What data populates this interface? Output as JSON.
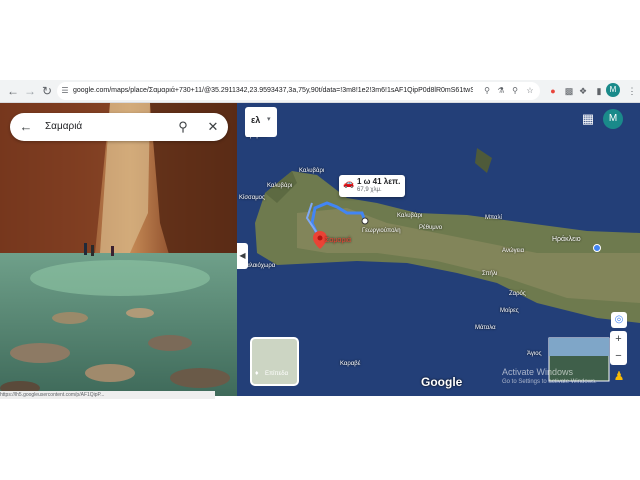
{
  "browser": {
    "url": "google.com/maps/place/Σαμαριά+730+11/@35.2911342,23.9593437,3a,75y,90t/data=!3m8!1e2!3m6!1sAF1QipP0d8lR0mS61twSbEwYPe8..."
  },
  "search": {
    "query": "Σαμαριά"
  },
  "map": {
    "language_label": "ελ",
    "route": {
      "duration": "1 ω 41 λεπ.",
      "distance": "67,9 χλμ."
    },
    "place_labels": {
      "thrymion": "Θρύμιον",
      "kissamos": "Κίσσαμος",
      "kalyvari": "Καλυβάρι",
      "samaria": "Σαμαριά",
      "paleochora": "Παλαιόχωρα",
      "georgioupoli": "Γεωργιούπολη",
      "rethymno": "Ρέθυμνο",
      "balli": "Μπαλί",
      "heraklion": "Ηράκλειο",
      "anogeia": "Ανώγεια",
      "zaros": "Ζαρός",
      "moires": "Μοίρες",
      "matala": "Μάταλα",
      "karave": "Καραβέ",
      "spili": "Σπήλι",
      "agios": "Άγιος"
    },
    "attribution": "Google",
    "layer_label": "Επίπεδα",
    "watermark": {
      "title": "Activate Windows",
      "subtitle": "Go to Settings to activate Windows."
    },
    "avatar_letter": "M"
  },
  "browser_avatar": "M",
  "status_url": "https://lh5.googleusercontent.com/p/AF1QipP..."
}
